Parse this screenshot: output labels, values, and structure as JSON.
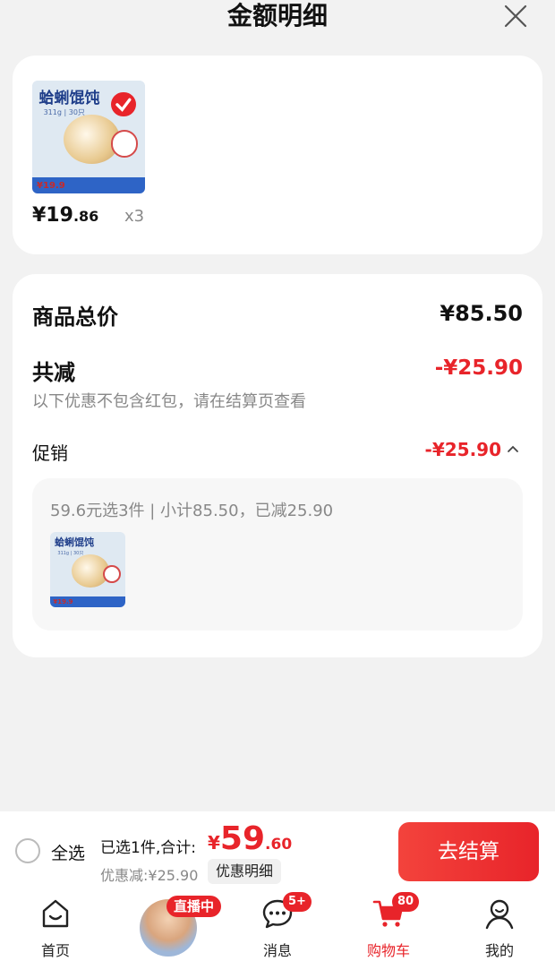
{
  "header": {
    "title": "金额明细",
    "close_icon": "close-icon"
  },
  "product": {
    "image_title": "蛤蜊馄饨",
    "image_sub": "311g | 30只",
    "image_price": "¥19.9",
    "price_int": "¥19",
    "price_dec": ".86",
    "qty": "x3",
    "selected_icon": "check-circle-icon"
  },
  "summary": {
    "total_label": "商品总价",
    "total_value": "¥85.50",
    "discount_label": "共减",
    "discount_value": "-¥25.90",
    "note": "以下优惠不包含红包，请在结算页查看",
    "promo_label": "促销",
    "promo_value": "-¥25.90",
    "promo_caret_icon": "chevron-up-icon",
    "promo_detail": "59.6元选3件 | 小计85.50，已减25.90"
  },
  "bottom_bar": {
    "select_all": "全选",
    "selected_text": "已选1件,合计:",
    "total_symbol": "¥",
    "total_int": "59",
    "total_dec": ".60",
    "saved_text": "优惠减:¥25.90",
    "detail_button": "优惠明细",
    "checkout_button": "去结算"
  },
  "tabbar": {
    "home": "首页",
    "live_badge": "直播中",
    "messages": "消息",
    "messages_badge": "5+",
    "cart": "购物车",
    "cart_badge": "80",
    "mine": "我的",
    "accent_color": "#e8242a"
  }
}
